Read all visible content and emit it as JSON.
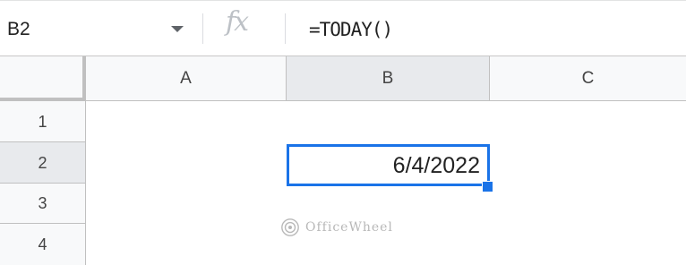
{
  "formula_bar": {
    "name_box": "B2",
    "fx_label": "fx",
    "formula": "=TODAY()"
  },
  "columns": [
    "A",
    "B",
    "C"
  ],
  "rows": [
    "1",
    "2",
    "3",
    "4"
  ],
  "active_cell": {
    "ref": "B2",
    "value": "6/4/2022"
  },
  "watermark": "OfficeWheel",
  "colors": {
    "selection": "#1a73e8",
    "header_bg": "#f8f9fa",
    "selected_header_bg": "#e8eaed"
  }
}
